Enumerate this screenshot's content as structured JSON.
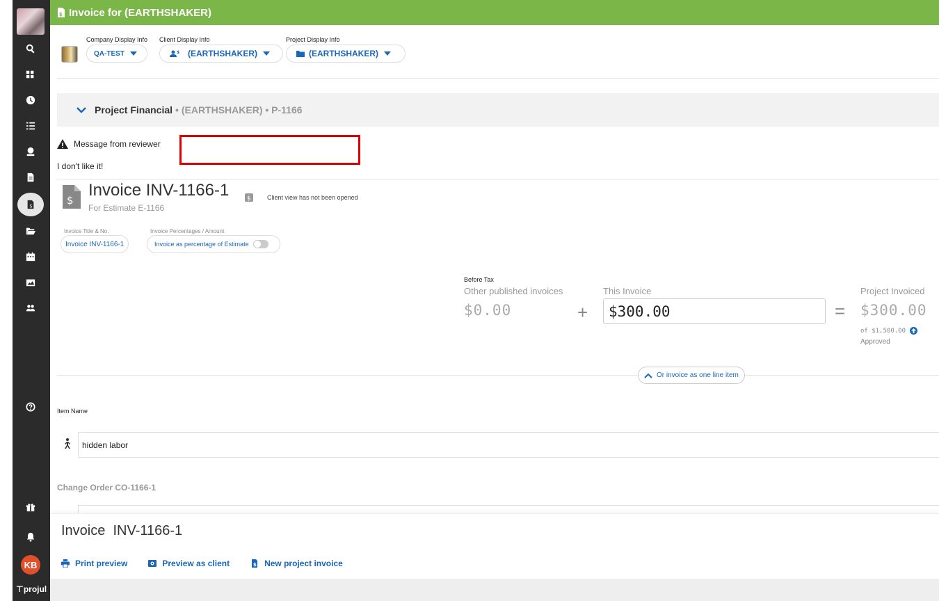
{
  "header": {
    "title": "Invoice for (EARTHSHAKER)"
  },
  "display_info": {
    "company": {
      "label": "Company Display Info",
      "value": "QA-TEST"
    },
    "client": {
      "label": "Client Display Info",
      "value": "(EARTHSHAKER)"
    },
    "project": {
      "label": "Project Display Info",
      "value": "(EARTHSHAKER)"
    }
  },
  "section": {
    "title": "Project Financial",
    "subtitle": "• (EARTHSHAKER) • P-1166"
  },
  "reviewer": {
    "label": "Message from reviewer",
    "message": "I don't like it!"
  },
  "invoice": {
    "title": "Invoice INV-1166-1",
    "subtitle": "For Estimate E-1166",
    "client_view": "Client view has not been opened",
    "title_no_label": "Invoice Title & No.",
    "title_no_value": "Invoice INV-1166-1",
    "percent_label": "Invoice Percentages / Amount",
    "percent_toggle": "Invoice as percentage of Estimate",
    "percent_toggle_on": false
  },
  "calc": {
    "before_tax": "Before Tax",
    "other_label": "Other published invoices",
    "other_value": "$0.00",
    "this_label": "This Invoice",
    "this_value": "$300.00",
    "project_label": "Project Invoiced",
    "project_value": "$300.00",
    "of_total": "of $1,500.00",
    "status": "Approved",
    "plus": "+",
    "equals": "="
  },
  "line_item_toggle": "Or invoice as one line item",
  "items": {
    "name_label": "Item Name",
    "first_item": "hidden labor",
    "change_order_title": "Change Order CO-1166-1"
  },
  "footer": {
    "title": "Invoice  INV-1166-1",
    "print_preview": "Print preview",
    "preview_client": "Preview as client",
    "new_invoice": "New project invoice"
  },
  "sidebar": {
    "user_initials": "KB",
    "brand": "projul"
  },
  "colors": {
    "topbar": "#7ab648",
    "sidebar": "#2b2b2b",
    "accent": "#1a66b8",
    "avatar": "#e2502b",
    "highlight": "#e00000"
  }
}
